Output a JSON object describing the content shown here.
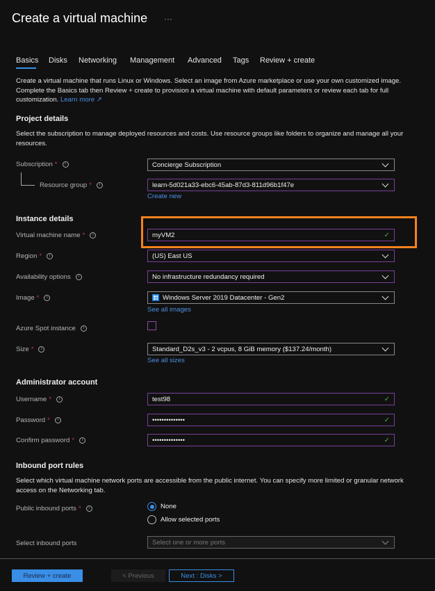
{
  "header": {
    "title": "Create a virtual machine",
    "more": "···"
  },
  "tabs": [
    "Basics",
    "Disks",
    "Networking",
    "Management",
    "Advanced",
    "Tags",
    "Review + create"
  ],
  "intro": {
    "text": "Create a virtual machine that runs Linux or Windows. Select an image from Azure marketplace or use your own customized image. Complete the Basics tab then Review + create to provision a virtual machine with default parameters or review each tab for full customization. ",
    "link": "Learn more ↗"
  },
  "project": {
    "heading": "Project details",
    "text": "Select the subscription to manage deployed resources and costs. Use resource groups like folders to organize and manage all your resources.",
    "subscription_label": "Subscription",
    "subscription_value": "Concierge Subscription",
    "rg_label": "Resource group",
    "rg_value": "learn-5d021a33-ebc6-45ab-87d3-811d96b1f47e",
    "create_new": "Create new"
  },
  "instance": {
    "heading": "Instance details",
    "vm_name_label": "Virtual machine name",
    "vm_name_value": "myVM2",
    "region_label": "Region",
    "region_value": "(US) East US",
    "availability_label": "Availability options",
    "availability_value": "No infrastructure redundancy required",
    "image_label": "Image",
    "image_value": "Windows Server 2019 Datacenter - Gen2",
    "see_all_images": "See all images",
    "spot_label": "Azure Spot instance",
    "size_label": "Size",
    "size_value": "Standard_D2s_v3 - 2 vcpus, 8 GiB memory ($137.24/month)",
    "see_all_sizes": "See all sizes"
  },
  "admin": {
    "heading": "Administrator account",
    "username_label": "Username",
    "username_value": "test98",
    "password_label": "Password",
    "password_value": "••••••••••••••",
    "confirm_label": "Confirm password",
    "confirm_value": "••••••••••••••"
  },
  "inbound": {
    "heading": "Inbound port rules",
    "text": "Select which virtual machine network ports are accessible from the public internet. You can specify more limited or granular network access on the Networking tab.",
    "public_label": "Public inbound ports",
    "option_none": "None",
    "option_allow": "Allow selected ports",
    "select_label": "Select inbound ports",
    "select_placeholder": "Select one or more ports"
  },
  "footer": {
    "review": "Review + create",
    "previous": "< Previous",
    "next": "Next : Disks >"
  },
  "common": {
    "req": "*",
    "info": "i",
    "check": "✓"
  },
  "colors": {
    "accent": "#3a8ee6",
    "highlight": "#f6821f",
    "valid": "#57a64a",
    "field_border": "#7a3f9a"
  }
}
